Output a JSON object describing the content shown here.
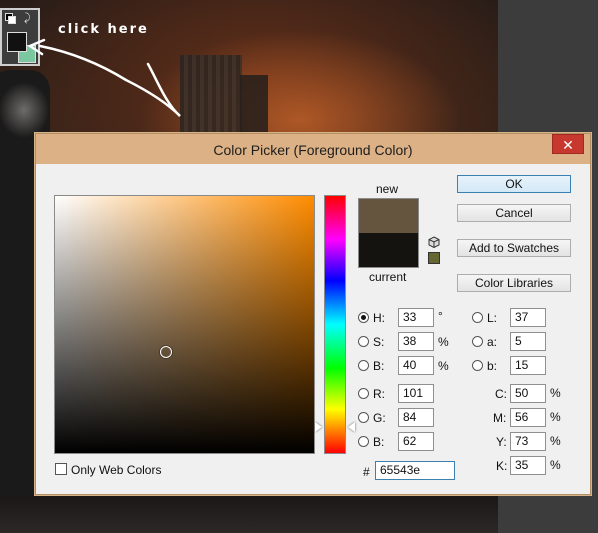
{
  "scene": {
    "annotation": "click here",
    "foreground_swatch_color": "#111111",
    "background_swatch_color": "#7bc8a0"
  },
  "dialog": {
    "title": "Color Picker (Foreground Color)",
    "close_glyph": "✕",
    "new_label": "new",
    "current_label": "current",
    "new_color": "#65543e",
    "current_color": "#151310",
    "websafe_color": "#666633",
    "buttons": {
      "ok": "OK",
      "cancel": "Cancel",
      "add_to_swatches": "Add to Swatches",
      "color_libraries": "Color Libraries"
    },
    "hsb": [
      {
        "key": "H",
        "label": "H:",
        "value": "33",
        "unit": "°",
        "selected": true
      },
      {
        "key": "S",
        "label": "S:",
        "value": "38",
        "unit": "%",
        "selected": false
      },
      {
        "key": "B",
        "label": "B:",
        "value": "40",
        "unit": "%",
        "selected": false
      }
    ],
    "rgb": [
      {
        "key": "R",
        "label": "R:",
        "value": "101"
      },
      {
        "key": "G",
        "label": "G:",
        "value": "84"
      },
      {
        "key": "B",
        "label": "B:",
        "value": "62"
      }
    ],
    "lab": [
      {
        "key": "L",
        "label": "L:",
        "value": "37"
      },
      {
        "key": "a",
        "label": "a:",
        "value": "5"
      },
      {
        "key": "b",
        "label": "b:",
        "value": "15"
      }
    ],
    "cmyk": [
      {
        "key": "C",
        "label": "C:",
        "value": "50",
        "unit": "%"
      },
      {
        "key": "M",
        "label": "M:",
        "value": "56",
        "unit": "%"
      },
      {
        "key": "Y",
        "label": "Y:",
        "value": "73",
        "unit": "%"
      },
      {
        "key": "K",
        "label": "K:",
        "value": "35",
        "unit": "%"
      }
    ],
    "hex_label": "#",
    "hex_value": "65543e",
    "only_web_colors_label": "Only Web Colors",
    "only_web_colors_checked": false,
    "hue_degrees": 33
  }
}
